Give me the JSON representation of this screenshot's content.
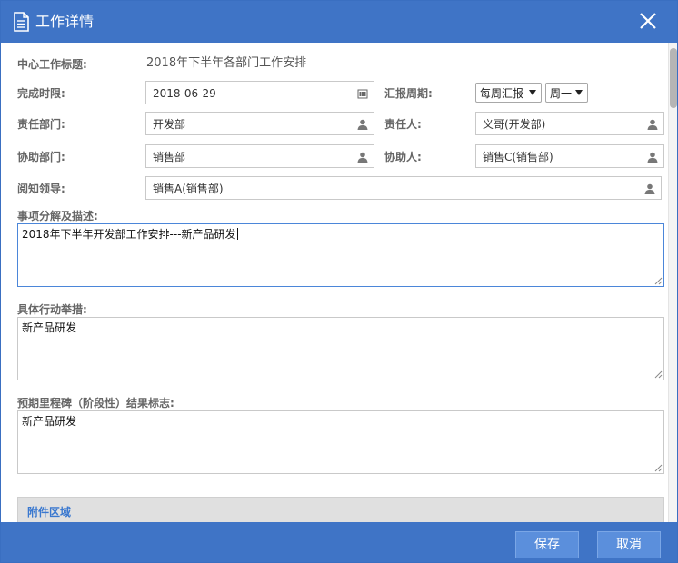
{
  "dialog": {
    "title": "工作详情"
  },
  "form": {
    "task_title_label": "中心工作标题:",
    "task_title_value": "2018年下半年各部门工作安排",
    "deadline_label": "完成时限:",
    "deadline_value": "2018-06-29",
    "report_cycle_label": "汇报周期:",
    "report_cycle_value": "每周汇报",
    "report_day_value": "周一",
    "dept_label": "责任部门:",
    "dept_value": "开发部",
    "owner_label": "责任人:",
    "owner_value": "义哥(开发部)",
    "assist_dept_label": "协助部门:",
    "assist_dept_value": "销售部",
    "assistant_label": "协助人:",
    "assistant_value": "销售C(销售部)",
    "leader_label": "阅知领导:",
    "leader_value": "销售A(销售部)",
    "description_label": "事项分解及描述:",
    "description_value": "2018年下半年开发部工作安排---新产品研发",
    "actions_label": "具体行动举措:",
    "actions_value": "新产品研发",
    "milestone_label": "预期里程碑（阶段性）结果标志:",
    "milestone_value": "新产品研发"
  },
  "attachments": {
    "title": "附件区域"
  },
  "footer": {
    "save_label": "保存",
    "cancel_label": "取消"
  },
  "colors": {
    "titlebar": "#3f74c6",
    "button": "#5b8fdc",
    "accent": "#3a78cf"
  }
}
